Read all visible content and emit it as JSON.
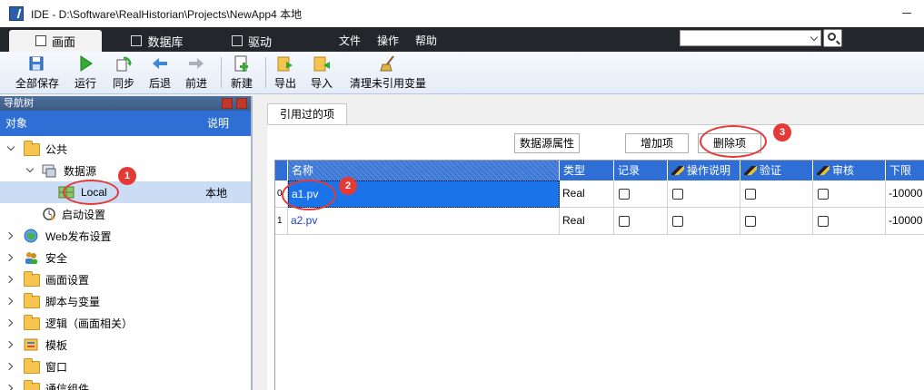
{
  "window": {
    "title": "IDE - D:\\Software\\RealHistorian\\Projects\\NewApp4  本地"
  },
  "menubar": {
    "tabs": [
      {
        "label": "画面",
        "icon": "screen-icon"
      },
      {
        "label": "数据库",
        "icon": "database-icon"
      },
      {
        "label": "驱动",
        "icon": "driver-icon"
      }
    ],
    "menus": [
      "文件",
      "操作",
      "帮助"
    ],
    "search": {
      "value": "",
      "placeholder": ""
    }
  },
  "toolbar": {
    "buttons": [
      {
        "label": "全部保存",
        "icon": "save-all-icon"
      },
      {
        "label": "运行",
        "icon": "run-icon"
      },
      {
        "label": "同步",
        "icon": "sync-icon"
      },
      {
        "label": "后退",
        "icon": "back-arrow-icon"
      },
      {
        "label": "前进",
        "icon": "forward-arrow-icon"
      },
      {
        "label": "新建",
        "icon": "new-icon"
      },
      {
        "label": "导出",
        "icon": "export-icon"
      },
      {
        "label": "导入",
        "icon": "import-icon"
      },
      {
        "label": "清理未引用变量",
        "icon": "broom-icon"
      }
    ]
  },
  "nav": {
    "title": "导航树",
    "col_object": "对象",
    "col_desc": "说明",
    "tree": [
      {
        "label": "公共"
      },
      {
        "label": "数据源"
      },
      {
        "label": "Local",
        "desc": "本地"
      },
      {
        "label": "启动设置"
      },
      {
        "label": "Web发布设置"
      },
      {
        "label": "安全"
      },
      {
        "label": "画面设置"
      },
      {
        "label": "脚本与变量"
      },
      {
        "label": "逻辑（画面相关）"
      },
      {
        "label": "模板"
      },
      {
        "label": "窗口"
      },
      {
        "label": "通信组件"
      }
    ]
  },
  "content": {
    "tab_label": "引用过的项",
    "buttons": {
      "datasource_props": "数据源属性",
      "add_item": "增加项",
      "delete_item": "删除项"
    },
    "grid": {
      "columns": [
        "名称",
        "类型",
        "记录",
        "操作说明",
        "验证",
        "审核",
        "下限"
      ],
      "rows": [
        {
          "index": "0",
          "name": "a1.pv",
          "type": "Real",
          "record": false,
          "op_desc": false,
          "verify": false,
          "audit": false,
          "lower": "-10000"
        },
        {
          "index": "1",
          "name": "a2.pv",
          "type": "Real",
          "record": false,
          "op_desc": false,
          "verify": false,
          "audit": false,
          "lower": "-10000"
        }
      ]
    }
  },
  "annotations": [
    "1",
    "2",
    "3"
  ],
  "colors": {
    "accent": "#2f6fd5",
    "selection": "#1a73e8",
    "annotation": "#e53935",
    "menubar": "#23262b"
  }
}
